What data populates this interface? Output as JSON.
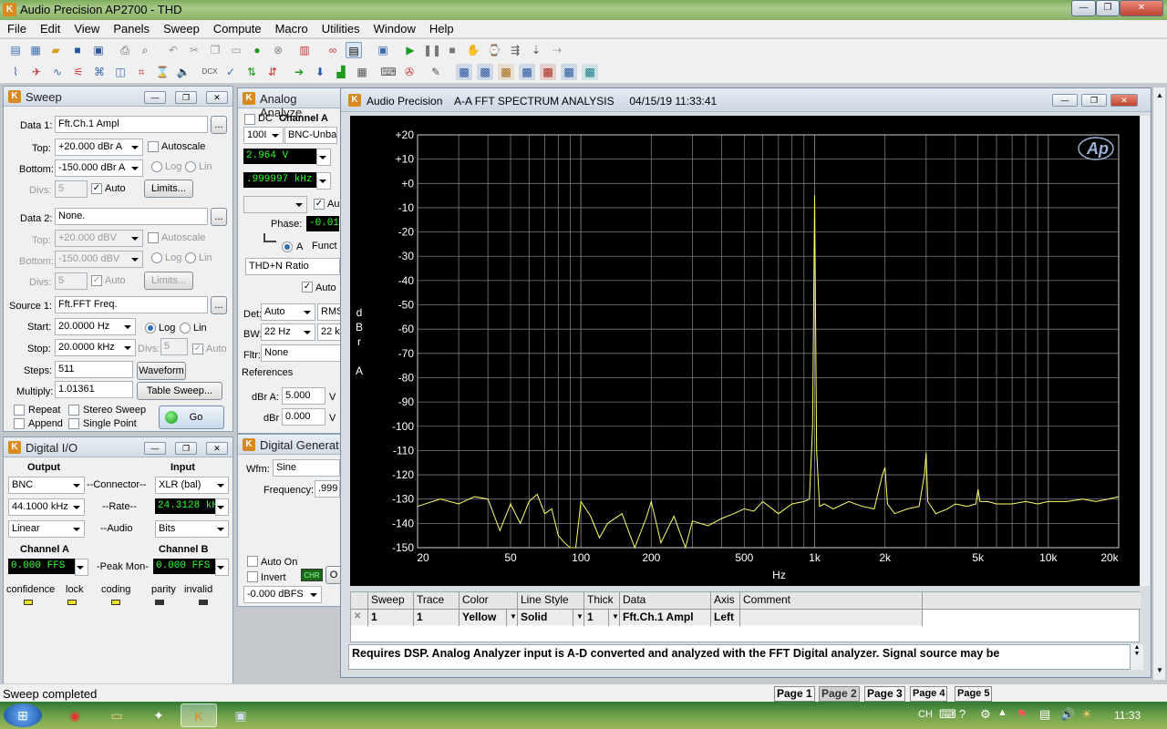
{
  "window": {
    "title": "Audio Precision AP2700 - THD",
    "min": "—",
    "max": "❐",
    "close": "✕"
  },
  "menu": [
    "File",
    "Edit",
    "View",
    "Panels",
    "Sweep",
    "Compute",
    "Macro",
    "Utilities",
    "Window",
    "Help"
  ],
  "sweep": {
    "title": "Sweep",
    "data1_label": "Data 1:",
    "data1": "Fft.Ch.1 Ampl",
    "top_label": "Top:",
    "top": "+20.000  dBr A",
    "bottom_label": "Bottom:",
    "bottom": "-150.000 dBr A",
    "autoscale": "Autoscale",
    "log": "Log",
    "lin": "Lin",
    "divs_label": "Divs:",
    "divs": "5",
    "auto": "Auto",
    "limits": "Limits...",
    "data2_label": "Data 2:",
    "data2": "None.",
    "top2": "+20.000  dBV",
    "bottom2": "-150.000 dBV",
    "divs2": "5",
    "source_label": "Source 1:",
    "source": "Fft.FFT Freq.",
    "start_label": "Start:",
    "start": "20.0000  Hz",
    "stop_label": "Stop:",
    "stop": "20.0000 kHz",
    "divs3": "5",
    "steps_label": "Steps:",
    "steps": "511",
    "waveform": "Waveform",
    "multiply_label": "Multiply:",
    "multiply": "1.01361",
    "table_sweep": "Table Sweep...",
    "repeat": "Repeat",
    "stereo": "Stereo Sweep",
    "append": "Append",
    "single": "Single Point",
    "go": "Go",
    "ellipsis": "..."
  },
  "digital": {
    "title": "Digital I/O",
    "output": "Output",
    "input": "Input",
    "out_conn": "BNC",
    "connector": "--Connector--",
    "in_conn": "XLR (bal)",
    "out_rate": "44.1000 kHz",
    "rate": "--Rate--",
    "in_rate": "24.3128 kHz",
    "out_audio": "Linear",
    "audio": "--Audio",
    "in_audio": "Bits",
    "chA": "Channel A",
    "peak": "-Peak Mon-",
    "chB": "Channel B",
    "chA_val": "0.000   FFS",
    "chB_val": "0.000   FFS",
    "confidence": "confidence",
    "lock": "lock",
    "coding": "coding",
    "parity": "parity",
    "invalid": "invalid"
  },
  "analog": {
    "title": "Analog Analyze",
    "dc": "DC",
    "channel_a": "Channel A",
    "range": "100I",
    "input": "BNC-Unba",
    "volt": "2.964   V",
    "freq": ".999997 kHz",
    "au": "Au",
    "phase_label": "Phase:",
    "phase": "-0.01",
    "a": "A",
    "func": "Funct",
    "func_val": "THD+N Ratio",
    "auto": "Auto",
    "det_label": "Det:",
    "det": "Auto",
    "rms": "RMS",
    "bw_label": "BW:",
    "bw": "22 Hz",
    "bw2": "22 k",
    "fltr_label": "Fltr:",
    "fltr": "None",
    "refs": "References",
    "dbra_label": "dBr A:",
    "dbra": "5.000",
    "dbra_unit": "V",
    "dbr_label": "dBr",
    "dbr": "0.000",
    "dbr_unit": "V"
  },
  "gen": {
    "title": "Digital Generat",
    "wfm_label": "Wfm:",
    "wfm": "Sine",
    "freq_label": "Frequency:",
    "freq": ".999",
    "auto_on": "Auto On",
    "invert": "Invert",
    "chr": "CHR",
    "o": "O",
    "level": "-0.000  dBFS"
  },
  "graph": {
    "title": "Audio Precision    A-A FFT SPECTRUM ANALYSIS     04/15/19 11:33:41",
    "ylabel": [
      "d",
      "B",
      "r",
      "",
      "A"
    ],
    "xlabel": "Hz",
    "logo": "Ap",
    "note": "Requires DSP.  Analog Analyzer input is A-D converted and analyzed with the FFT Digital analyzer.  Signal source may be",
    "table_headers": [
      "Sweep",
      "Trace",
      "Color",
      "Line Style",
      "Thick",
      "Data",
      "Axis",
      "Comment"
    ],
    "table_row": [
      "1",
      "1",
      "Yellow",
      "Solid",
      "1",
      "Fft.Ch.1 Ampl",
      "Left",
      ""
    ]
  },
  "chart_data": {
    "type": "line",
    "title": "A-A FFT SPECTRUM ANALYSIS",
    "xlabel": "Hz",
    "ylabel": "dBr A",
    "xscale": "log",
    "xlim": [
      20,
      20000
    ],
    "ylim": [
      -150,
      20
    ],
    "x_ticks": [
      "20",
      "50",
      "100",
      "200",
      "500",
      "1k",
      "2k",
      "5k",
      "10k",
      "20k"
    ],
    "y_ticks": [
      "+20",
      "+10",
      "+0",
      "-10",
      "-20",
      "-30",
      "-40",
      "-50",
      "-60",
      "-70",
      "-80",
      "-90",
      "-100",
      "-110",
      "-120",
      "-130",
      "-140",
      "-150"
    ],
    "series": [
      {
        "color": "#ffff66",
        "x": [
          20,
          25,
          30,
          35,
          40,
          45,
          50,
          55,
          60,
          65,
          70,
          75,
          80,
          85,
          90,
          95,
          100,
          110,
          120,
          130,
          150,
          170,
          190,
          200,
          220,
          250,
          280,
          300,
          350,
          400,
          450,
          500,
          550,
          600,
          700,
          800,
          900,
          950,
          980,
          1000,
          1020,
          1050,
          1100,
          1200,
          1400,
          1600,
          1800,
          1950,
          2000,
          2050,
          2200,
          2500,
          2800,
          2950,
          3000,
          3050,
          3300,
          3700,
          4000,
          4500,
          4900,
          5000,
          5100,
          5500,
          6000,
          7000,
          8000,
          9000,
          10000,
          12000,
          14000,
          16000,
          18000,
          20000
        ],
        "y": [
          -133,
          -130,
          -132,
          -129,
          -130,
          -143,
          -132,
          -140,
          -131,
          -128,
          -136,
          -134,
          -145,
          -148,
          -150,
          -150,
          -131,
          -137,
          -146,
          -140,
          -136,
          -150,
          -138,
          -131,
          -148,
          -137,
          -150,
          -139,
          -141,
          -138,
          -136,
          -134,
          -135,
          -131,
          -136,
          -132,
          -131,
          -130,
          -100,
          -5,
          -110,
          -133,
          -132,
          -134,
          -131,
          -133,
          -134,
          -120,
          -117,
          -132,
          -136,
          -134,
          -133,
          -120,
          -111,
          -131,
          -136,
          -134,
          -132,
          -133,
          -132,
          -126,
          -131,
          -131,
          -132,
          -132,
          -131,
          -132,
          -131,
          -131,
          -130,
          -131,
          -130,
          -129
        ]
      }
    ]
  },
  "pages": [
    "Page 1",
    "Page 2",
    "Page 3",
    "Page 4",
    "Page 5"
  ],
  "status": "Sweep completed",
  "tray": {
    "lang": "CH",
    "time": "11:33"
  }
}
